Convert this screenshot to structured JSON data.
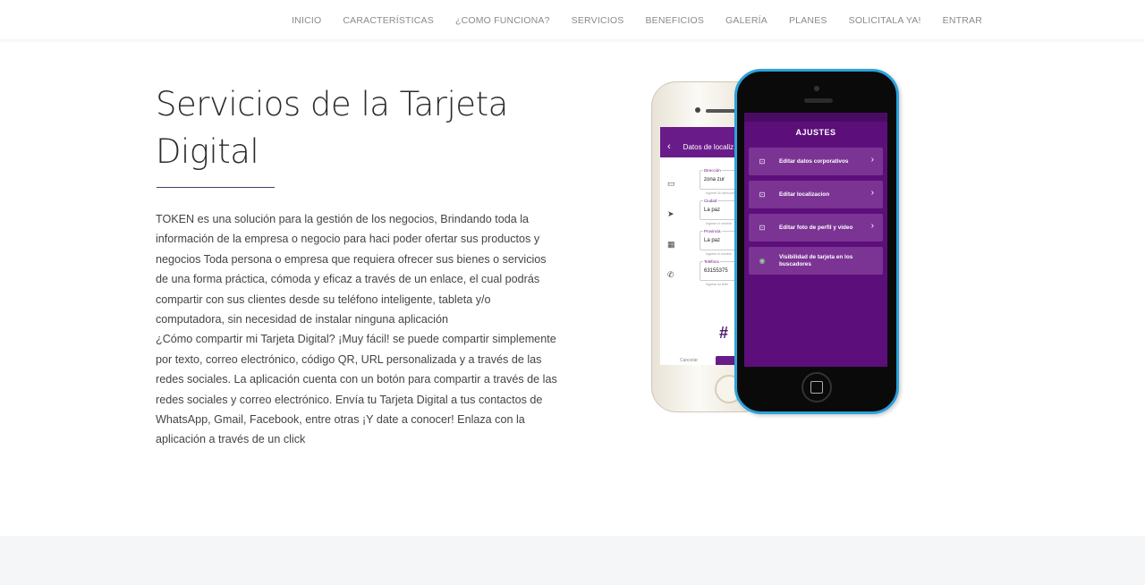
{
  "nav": {
    "items": [
      {
        "label": "INICIO"
      },
      {
        "label": "CARACTERÍSTICAS"
      },
      {
        "label": "¿COMO FUNCIONA?"
      },
      {
        "label": "SERVICIOS"
      },
      {
        "label": "BENEFICIOS"
      },
      {
        "label": "GALERÍA"
      },
      {
        "label": "PLANES"
      },
      {
        "label": "SOLICITALA YA!"
      },
      {
        "label": "ENTRAR"
      }
    ]
  },
  "section": {
    "title_line1": "Servicios de la Tarjeta",
    "title_line2": "Digital",
    "paragraph1": "TOKEN es una solución para la gestión de los negocios, Brindando toda la información de la empresa o negocio para haci poder ofertar sus productos y negocios Toda persona o empresa que requiera ofrecer sus bienes o servicios de una forma práctica, cómoda y eficaz a través de un enlace, el cual podrás compartir con sus clientes desde su teléfono inteligente, tableta y/o computadora, sin necesidad de instalar ninguna aplicación",
    "paragraph2": "¿Cómo compartir mi Tarjeta Digital? ¡Muy fácil! se puede compartir simplemente por texto, correo electrónico, código QR, URL personalizada y a través de las redes sociales. La aplicación cuenta con un botón para compartir a través de las redes sociales y correo electrónico. Envía tu Tarjeta Digital a tus contactos de WhatsApp, Gmail, Facebook, entre otras ¡Y date a conocer! Enlaza con la aplicación a través de un click"
  },
  "phone_white": {
    "header": "Datos de localiz",
    "fields": [
      {
        "label": "Dirección",
        "value": "zona zur",
        "hint": "Ingrese Su dirección",
        "icon": "id-card-icon"
      },
      {
        "label": "Ciudad",
        "value": "La paz",
        "hint": "Ingrese el nombre",
        "icon": "navigation-icon"
      },
      {
        "label": "Provincia",
        "value": "La paz",
        "hint": "Ingrese el nombre",
        "icon": "map-icon"
      },
      {
        "label": "Teléfono",
        "value": "63155375",
        "hint": "Ingrese su teléf",
        "icon": "phone-icon"
      }
    ],
    "hash": "#",
    "cancel": "Cancelar"
  },
  "phone_blue": {
    "screen_title": "AJUSTES",
    "items": [
      {
        "label": "Editar datos corporativos",
        "icon": "settings-square-icon"
      },
      {
        "label": "Editar localizacion",
        "icon": "settings-square-icon"
      },
      {
        "label": "Editar foto de perfil y video",
        "icon": "settings-square-icon"
      },
      {
        "label": "Visibilidad de tarjeta en los buscadores",
        "icon": "eye-icon"
      }
    ],
    "accent": "#5c0f7a",
    "frame": "#2ba3db"
  }
}
